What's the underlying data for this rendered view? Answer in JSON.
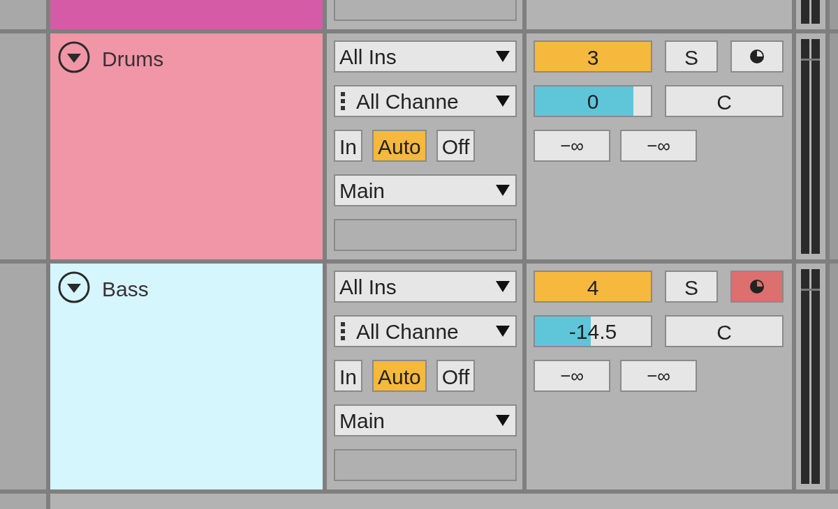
{
  "top_track": {
    "color": "#d65ba6"
  },
  "tracks": [
    {
      "name": "Drums",
      "color": "#f196a7",
      "input_type": "All Ins",
      "input_channel": "All Channe",
      "monitor": [
        {
          "label": "In",
          "selected": false
        },
        {
          "label": "Auto",
          "selected": true
        },
        {
          "label": "Off",
          "selected": false
        }
      ],
      "output": "Main",
      "number": "3",
      "solo": {
        "label": "S",
        "selected": false
      },
      "armed": false,
      "volume": {
        "reading": "0",
        "level": 0.85
      },
      "pan": "C",
      "sends": [
        "−∞",
        "−∞"
      ]
    },
    {
      "name": "Bass",
      "color": "#d5f6fd",
      "input_type": "All Ins",
      "input_channel": "All Channe",
      "monitor": [
        {
          "label": "In",
          "selected": false
        },
        {
          "label": "Auto",
          "selected": true
        },
        {
          "label": "Off",
          "selected": false
        }
      ],
      "output": "Main",
      "number": "4",
      "solo": {
        "label": "S",
        "selected": false
      },
      "armed": true,
      "volume": {
        "reading": "-14.5",
        "level": 0.48
      },
      "pan": "C",
      "sends": [
        "−∞",
        "−∞"
      ]
    }
  ]
}
